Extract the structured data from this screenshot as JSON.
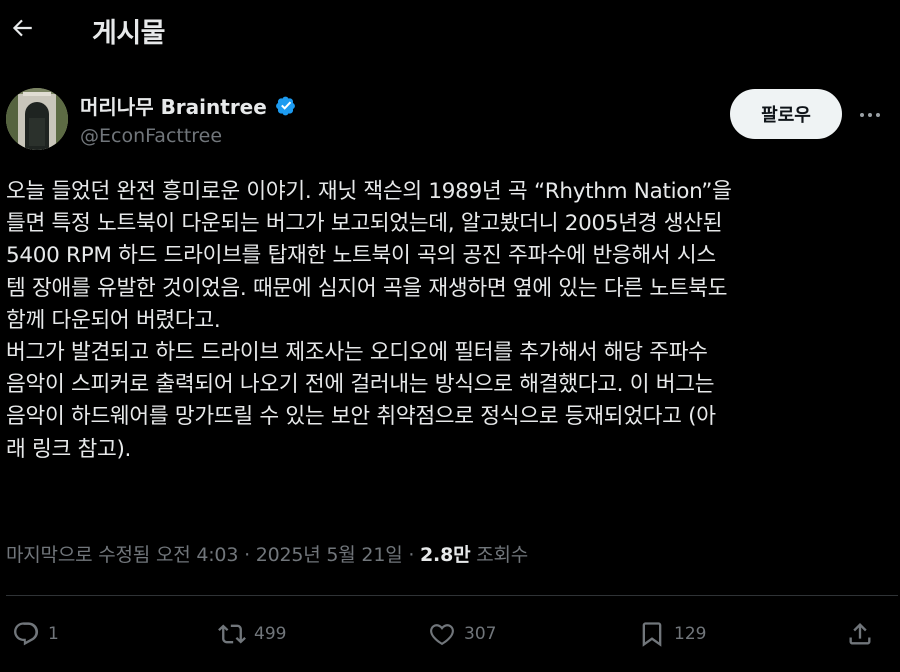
{
  "header": {
    "back_icon": "arrow-left-icon",
    "title": "게시물"
  },
  "author": {
    "display_name": "머리나무 Braintree",
    "handle": "@EconFacttree",
    "verified_color": "#1d9bf0",
    "avatar_icon": "avatar-door-photo"
  },
  "follow": {
    "label": "팔로우"
  },
  "more_icon": "more-dots-icon",
  "post": {
    "lines": [
      "오늘 들었던 완전 흥미로운 이야기. 재닛 잭슨의 1989년 곡 “Rhythm Nation”을",
      "틀면 특정 노트북이 다운되는 버그가 보고되었는데, 알고봤더니 2005년경 생산된",
      "5400 RPM 하드 드라이브를 탑재한 노트북이 곡의 공진 주파수에 반응해서 시스",
      "템 장애를 유발한 것이었음. 때문에 심지어 곡을 재생하면 옆에 있는 다른 노트북도",
      "함께 다운되어 버렸다고.",
      "버그가 발견되고 하드 드라이브 제조사는 오디오에 필터를 추가해서 해당 주파수",
      "음악이 스피커로 출력되어 나오기 전에 걸러내는 방식으로 해결했다고. 이 버그는",
      "음악이 하드웨어를 망가뜨릴 수 있는 보안 취약점으로 정식으로 등재되었다고 (아",
      "래 링크 참고)."
    ]
  },
  "meta": {
    "edited": "마지막으로 수정됨",
    "time": "오전 4:03",
    "date": "2025년 5월 21일",
    "views_count": "2.8만",
    "views_label": "조회수"
  },
  "actions": {
    "reply": {
      "icon": "reply-icon",
      "count": "1"
    },
    "repost": {
      "icon": "repost-icon",
      "count": "499"
    },
    "like": {
      "icon": "heart-icon",
      "count": "307"
    },
    "bookmark": {
      "icon": "bookmark-icon",
      "count": "129"
    },
    "share": {
      "icon": "share-icon"
    }
  }
}
